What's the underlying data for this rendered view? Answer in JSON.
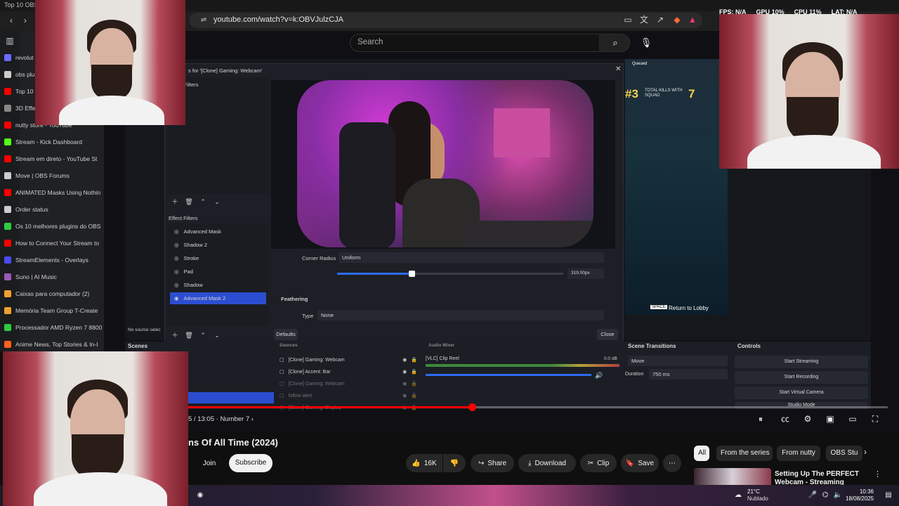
{
  "browser": {
    "tab_title": "Top 10 OBS F",
    "url": "youtube.com/watch?v=k:OBVJulzCJA"
  },
  "tabs": [
    {
      "label": "revolut",
      "color": "#6b6bff"
    },
    {
      "label": "obs plu",
      "color": "#cccccc"
    },
    {
      "label": "Top 10",
      "color": "#ff0000"
    },
    {
      "label": "3D Effec",
      "color": "#888888"
    },
    {
      "label": "nutty store - YouTube",
      "color": "#ff0000"
    },
    {
      "label": "Stream - Kick Dashboard",
      "color": "#53fc18"
    },
    {
      "label": "Stream em direto - YouTube St",
      "color": "#ff0000"
    },
    {
      "label": "Move | OBS Forums",
      "color": "#cccccc"
    },
    {
      "label": "ANIMATED Masks Using Nothin",
      "color": "#ff0000"
    },
    {
      "label": "Order status",
      "color": "#cccccc"
    },
    {
      "label": "Os 10 melhores plugins do OBS",
      "color": "#2ecc40"
    },
    {
      "label": "How to Connect Your Stream to",
      "color": "#ff0000"
    },
    {
      "label": "StreamElements - Overlays",
      "color": "#4b4bff"
    },
    {
      "label": "Suno | AI Music",
      "color": "#9b59b6"
    },
    {
      "label": "Caixas para computador (2)",
      "color": "#f0a030"
    },
    {
      "label": "Memória Team Group T-Create",
      "color": "#f0a030"
    },
    {
      "label": "Processador AMD Ryzen 7 8800",
      "color": "#2ecc40"
    },
    {
      "label": "Anime News, Top Stories & In-I",
      "color": "#ff6020"
    }
  ],
  "hud": {
    "fps_label": "FPS:",
    "fps_value": "N/A",
    "gpu_label": "GPU",
    "gpu_value": "10%",
    "cpu_label": "CPU",
    "cpu_value": "11%",
    "lat_label": "LAT:",
    "lat_value": "N/A"
  },
  "youtube": {
    "search_placeholder": "Search",
    "time": "5 / 13:05",
    "chapter": "Number 7",
    "title": "ns Of All Time (2024)",
    "join": "Join",
    "subscribe": "Subscribe",
    "likes": "16K",
    "share": "Share",
    "download": "Download",
    "clip": "Clip",
    "save": "Save",
    "progress_fraction": 0.408,
    "chips": [
      {
        "label": "All",
        "active": true
      },
      {
        "label": "From the series",
        "active": false
      },
      {
        "label": "From nutty",
        "active": false
      },
      {
        "label": "OBS Stu",
        "active": false
      }
    ],
    "reco_title": "Setting Up The PERFECT Webcam - Streaming"
  },
  "obs": {
    "dialog_title": "s for '[Clone] Gaming: Webcam'",
    "filters_head": "Filters",
    "effect_filters_head": "Effect Filters",
    "filters": [
      {
        "label": "Advanced Mask",
        "selected": false
      },
      {
        "label": "Shadow 2",
        "selected": false
      },
      {
        "label": "Stroke",
        "selected": false
      },
      {
        "label": "Pad",
        "selected": false
      },
      {
        "label": "Shadow",
        "selected": false
      },
      {
        "label": "Advanced Mask 2",
        "selected": true
      }
    ],
    "corner_radius_label": "Corner Radius",
    "corner_radius_value": "Uniform",
    "slider_value_text": "319.00px",
    "slider_fraction": 0.33,
    "feathering": "Feathering",
    "type_label": "Type",
    "type_value": "None",
    "defaults_btn": "Defaults",
    "close_btn": "Close",
    "no_source": "No source selec",
    "scenes_head": "Scenes",
    "sources_head": "Sources",
    "audio_head": "Audio Mixer",
    "transitions_head": "Scene Transitions",
    "controls_head": "Controls",
    "sources": [
      {
        "label": "[Clone] Gaming: Webcam"
      },
      {
        "label": "[Clone] Accent: Bar"
      },
      {
        "label": "[Clone] Gaming: Webcam"
      },
      {
        "label": "follow alert"
      },
      {
        "label": "[Clone] Gaming: Display"
      }
    ],
    "mixer_label": "[VLC] Clip Reel",
    "mixer_db": "0.0 dB",
    "transition_value": "Move",
    "duration_label": "Duration",
    "duration_value": "750 ms",
    "controls": [
      "Start Streaming",
      "Start Recording",
      "Start Virtual Camera",
      "Studio Mode"
    ]
  },
  "game": {
    "queued": "Queued",
    "rank": "#3",
    "kills_label": "TOTAL KILLS WITH SQUAD",
    "kills_value": "7",
    "space": "SPACE",
    "return": "Return to Lobby"
  },
  "taskbar": {
    "temp": "21°C",
    "weather": "Nublado",
    "time": "10:36",
    "date": "18/08/2025"
  }
}
